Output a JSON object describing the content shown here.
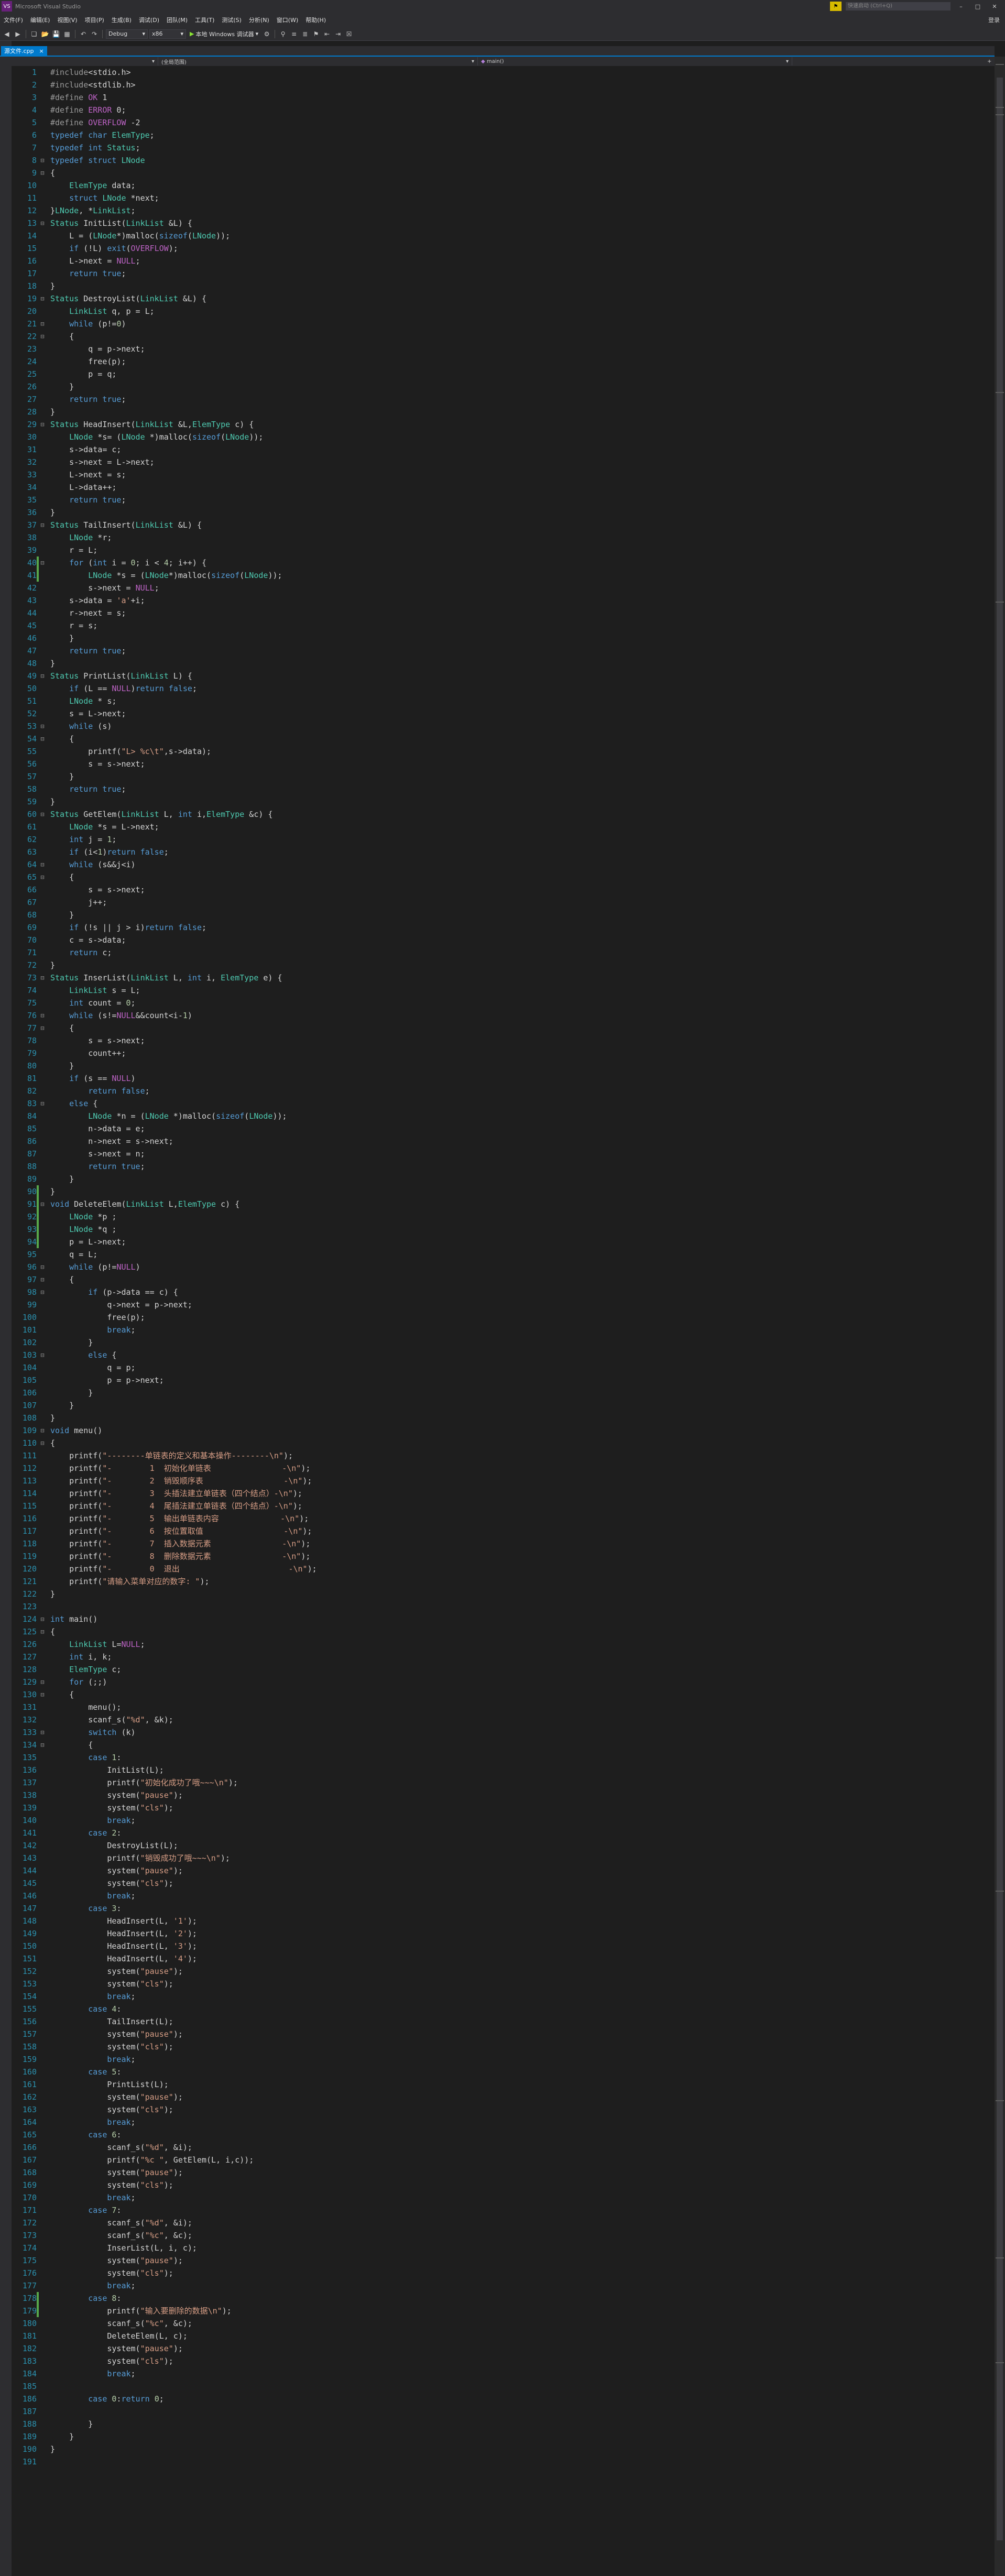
{
  "titlebar": {
    "window_title": "Microsoft Visual Studio",
    "quick_launch": "快速启动 (Ctrl+Q)"
  },
  "menu": [
    "文件(F)",
    "编辑(E)",
    "视图(V)",
    "项目(P)",
    "生成(B)",
    "调试(D)",
    "团队(M)",
    "工具(T)",
    "测试(S)",
    "分析(N)",
    "窗口(W)",
    "帮助(H)"
  ],
  "menu_right": "登录",
  "toolbar": {
    "config": "Debug",
    "platform": "x86",
    "run_label": "本地 Windows 调试器"
  },
  "tab": {
    "label": "源文件.cpp",
    "close": "×"
  },
  "nav": {
    "scope": "(全局范围)",
    "func": "main()"
  },
  "code": [
    "#include<stdio.h>",
    "#include<stdlib.h>",
    "#define OK 1",
    "#define ERROR 0;",
    "#define OVERFLOW -2",
    "typedef char ElemType;",
    "typedef int Status;",
    "typedef struct LNode",
    "{",
    "    ElemType data;",
    "    struct LNode *next;",
    "}LNode, *LinkList;",
    "Status InitList(LinkList &L) {",
    "    L = (LNode*)malloc(sizeof(LNode));",
    "    if (!L) exit(OVERFLOW);",
    "    L->next = NULL;",
    "    return true;",
    "}",
    "Status DestroyList(LinkList &L) {",
    "    LinkList q, p = L;",
    "    while (p!=0)",
    "    {",
    "        q = p->next;",
    "        free(p);",
    "        p = q;",
    "    }",
    "    return true;",
    "}",
    "Status HeadInsert(LinkList &L,ElemType c) {",
    "    LNode *s= (LNode *)malloc(sizeof(LNode));",
    "    s->data= c;",
    "    s->next = L->next;",
    "    L->next = s;",
    "    L->data++;",
    "    return true;",
    "}",
    "Status TailInsert(LinkList &L) {",
    "    LNode *r;",
    "    r = L;",
    "    for (int i = 0; i < 4; i++) {",
    "        LNode *s = (LNode*)malloc(sizeof(LNode));",
    "        s->next = NULL;",
    "    s->data = 'a'+i;",
    "    r->next = s;",
    "    r = s;",
    "    }",
    "    return true;",
    "}",
    "Status PrintList(LinkList L) {",
    "    if (L == NULL)return false;",
    "    LNode * s;",
    "    s = L->next;",
    "    while (s)",
    "    {",
    "        printf(\"L> %c\\t\",s->data);",
    "        s = s->next;",
    "    }",
    "    return true;",
    "}",
    "Status GetElem(LinkList L, int i,ElemType &c) {",
    "    LNode *s = L->next;",
    "    int j = 1;",
    "    if (i<1)return false;",
    "    while (s&&j<i)",
    "    {",
    "        s = s->next;",
    "        j++;",
    "    }",
    "    if (!s || j > i)return false;",
    "    c = s->data;",
    "    return c;",
    "}",
    "Status InserList(LinkList L, int i, ElemType e) {",
    "    LinkList s = L;",
    "    int count = 0;",
    "    while (s!=NULL&&count<i-1)",
    "    {",
    "        s = s->next;",
    "        count++;",
    "    }",
    "    if (s == NULL)",
    "        return false;",
    "    else {",
    "        LNode *n = (LNode *)malloc(sizeof(LNode));",
    "        n->data = e;",
    "        n->next = s->next;",
    "        s->next = n;",
    "        return true;",
    "    }",
    "}",
    "void DeleteElem(LinkList L,ElemType c) {",
    "    LNode *p ;",
    "    LNode *q ;",
    "    p = L->next;",
    "    q = L;",
    "    while (p!=NULL)",
    "    {",
    "        if (p->data == c) {",
    "            q->next = p->next;",
    "            free(p);",
    "            break;",
    "        }",
    "        else {",
    "            q = p;",
    "            p = p->next;",
    "        }",
    "    }",
    "}",
    "void menu()",
    "{",
    "    printf(\"--------单链表的定义和基本操作--------\\n\");",
    "    printf(\"-        1  初始化单链表               -\\n\");",
    "    printf(\"-        2  销毁顺序表                 -\\n\");",
    "    printf(\"-        3  头插法建立单链表（四个结点）-\\n\");",
    "    printf(\"-        4  尾插法建立单链表（四个结点）-\\n\");",
    "    printf(\"-        5  输出单链表内容             -\\n\");",
    "    printf(\"-        6  按位置取值                 -\\n\");",
    "    printf(\"-        7  插入数据元素               -\\n\");",
    "    printf(\"-        8  删除数据元素               -\\n\");",
    "    printf(\"-        0  退出                       -\\n\");",
    "    printf(\"请输入菜单对应的数字: \");",
    "}",
    "",
    "int main()",
    "{",
    "    LinkList L=NULL;",
    "    int i, k;",
    "    ElemType c;",
    "    for (;;)",
    "    {",
    "        menu();",
    "        scanf_s(\"%d\", &k);",
    "        switch (k)",
    "        {",
    "        case 1:",
    "            InitList(L);",
    "            printf(\"初始化成功了哦~~~\\n\");",
    "            system(\"pause\");",
    "            system(\"cls\");",
    "            break;",
    "        case 2:",
    "            DestroyList(L);",
    "            printf(\"销毁成功了哦~~~\\n\");",
    "            system(\"pause\");",
    "            system(\"cls\");",
    "            break;",
    "        case 3:",
    "            HeadInsert(L, '1');",
    "            HeadInsert(L, '2');",
    "            HeadInsert(L, '3');",
    "            HeadInsert(L, '4');",
    "            system(\"pause\");",
    "            system(\"cls\");",
    "            break;",
    "        case 4:",
    "            TailInsert(L);",
    "            system(\"pause\");",
    "            system(\"cls\");",
    "            break;",
    "        case 5:",
    "            PrintList(L);",
    "            system(\"pause\");",
    "            system(\"cls\");",
    "            break;",
    "        case 6:",
    "            scanf_s(\"%d\", &i);",
    "            printf(\"%c \", GetElem(L, i,c));",
    "            system(\"pause\");",
    "            system(\"cls\");",
    "            break;",
    "        case 7:",
    "            scanf_s(\"%d\", &i);",
    "            scanf_s(\"%c\", &c);",
    "            InserList(L, i, c);",
    "            system(\"pause\");",
    "            system(\"cls\");",
    "            break;",
    "        case 8:",
    "            printf(\"输入要删除的数据\\n\");",
    "            scanf_s(\"%c\", &c);",
    "            DeleteElem(L, c);",
    "            system(\"pause\");",
    "            system(\"cls\");",
    "            break;",
    "",
    "        case 0:return 0;",
    "",
    "        }",
    "    }",
    "}",
    ""
  ],
  "colors": {
    "bg": "#1e1e1e",
    "keyword": "#569cd6",
    "type": "#4ec9b0",
    "string": "#d69d85",
    "preprocessor": "#9b9b9b",
    "macro": "#bd63c5",
    "number": "#b5cea8",
    "linenumber": "#2b91af",
    "accent": "#007acc"
  }
}
